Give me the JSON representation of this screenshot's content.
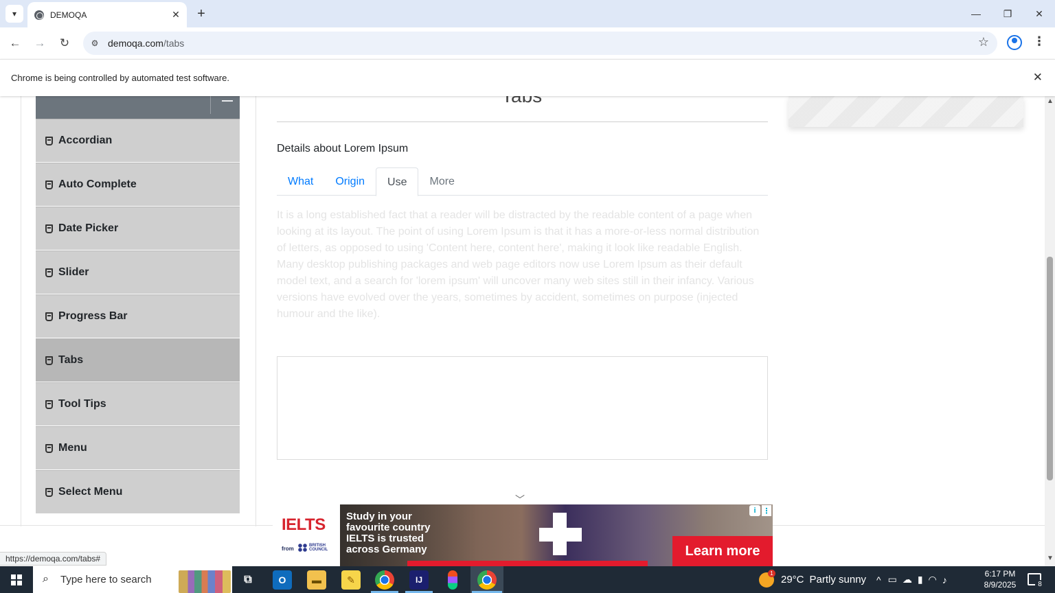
{
  "browser": {
    "tab_title": "DEMOQA",
    "url_host": "demoqa.com",
    "url_path": "/tabs",
    "infobar_message": "Chrome is being controlled by automated test software.",
    "status_url": "https://demoqa.com/tabs#"
  },
  "icons": {
    "tab_search": "chevron-down-icon",
    "tab_close": "close-icon",
    "new_tab": "plus-icon",
    "minimize": "minimize-icon",
    "restore": "restore-icon",
    "close_window": "close-icon",
    "back": "arrow-left-icon",
    "forward": "arrow-right-icon",
    "reload": "reload-icon",
    "site_info": "tune-icon",
    "bookmark": "star-icon",
    "profile": "account-icon",
    "menu": "kebab-menu-icon"
  },
  "sidebar": {
    "items": [
      {
        "label": "Accordian",
        "active": false
      },
      {
        "label": "Auto Complete",
        "active": false
      },
      {
        "label": "Date Picker",
        "active": false
      },
      {
        "label": "Slider",
        "active": false
      },
      {
        "label": "Progress Bar",
        "active": false
      },
      {
        "label": "Tabs",
        "active": true
      },
      {
        "label": "Tool Tips",
        "active": false
      },
      {
        "label": "Menu",
        "active": false
      },
      {
        "label": "Select Menu",
        "active": false
      }
    ]
  },
  "main": {
    "page_title": "Tabs",
    "details_text": "Details about Lorem Ipsum",
    "tabs": [
      {
        "label": "What",
        "state": "normal"
      },
      {
        "label": "Origin",
        "state": "normal"
      },
      {
        "label": "Use",
        "state": "active"
      },
      {
        "label": "More",
        "state": "disabled"
      }
    ],
    "active_tab_content": "It is a long established fact that a reader will be distracted by the readable content of a page when looking at its layout. The point of using Lorem Ipsum is that it has a more-or-less normal distribution of letters, as opposed to using 'Content here, content here', making it look like readable English. Many desktop publishing packages and web page editors now use Lorem Ipsum as their default model text, and a search for 'lorem ipsum' will uncover many web sites still in their infancy. Various versions have evolved over the years, sometimes by accident, sometimes on purpose (injected humour and the like)."
  },
  "ad": {
    "brand": "IELTS",
    "from_text": "from",
    "partner": "BRITISH COUNCIL",
    "headline": "Study in your favourite country IELTS is trusted across Germany",
    "cta": "Learn more",
    "info_label": "i",
    "more_label": "⋮"
  },
  "taskbar": {
    "search_placeholder": "Type here to search",
    "weather_temp": "29°C",
    "weather_desc": "Partly sunny",
    "weather_badge": "1",
    "time": "6:17 PM",
    "date": "8/9/2025",
    "notification_count": "8"
  },
  "colors": {
    "link_blue": "#007bff",
    "sidebar_item": "#cfcfcf",
    "sidebar_active": "#b7b7b7",
    "group_header": "#6c757d",
    "ad_red": "#e31b2d",
    "taskbar": "#1f2a36"
  }
}
